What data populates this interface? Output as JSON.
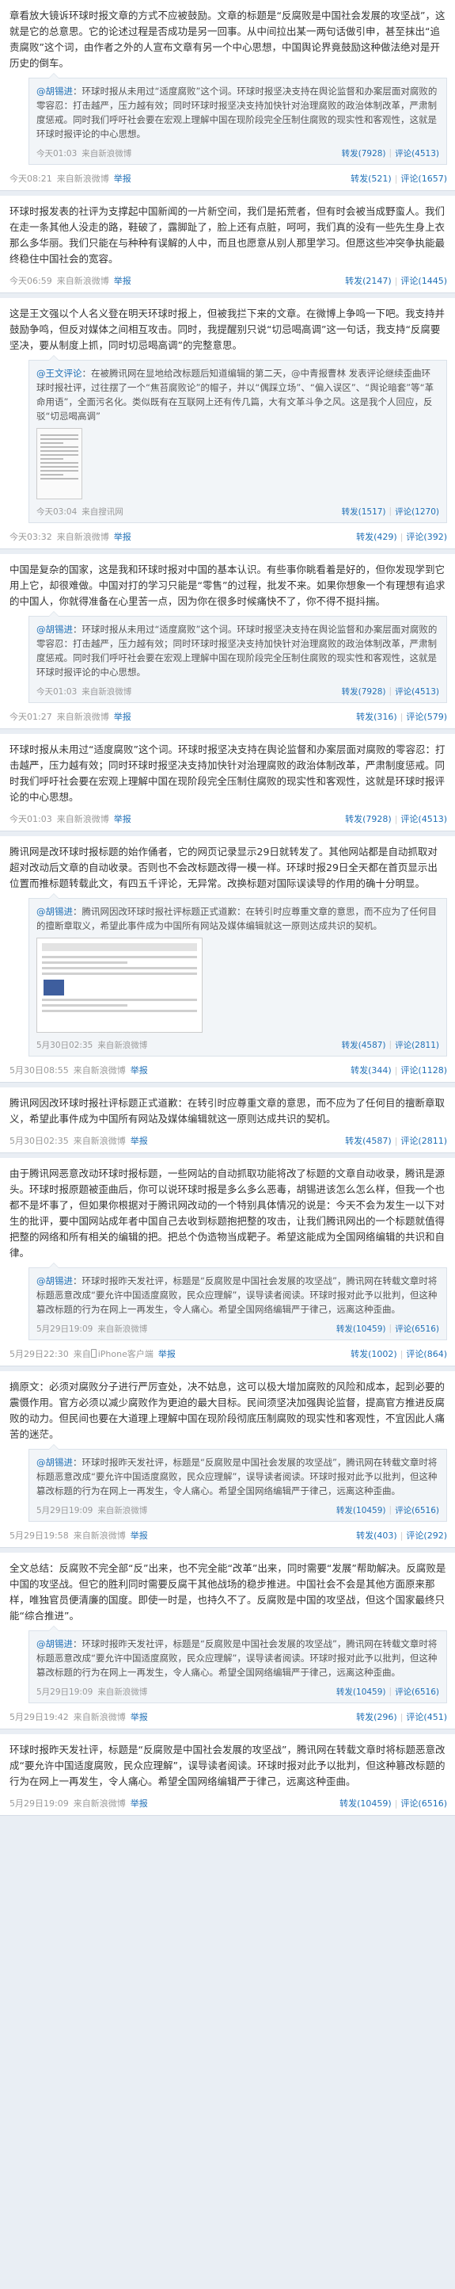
{
  "labels": {
    "forward": "转发",
    "comment": "评论",
    "report": "举报",
    "source_prefix": "来自"
  },
  "posts": [
    {
      "text": "章看放大镜诉环球时报文章的方式不应被鼓励。文章的标题是“反腐败是中国社会发展的攻坚战”，这就是它的总意思。它的论述过程是否成功是另一回事。从中间拉出某一两句话做引申，甚至抹出“追责腐败”这个词，由作者之外的人宣布文章有另一个中心思想，中国舆论界竟鼓励这种做法绝对是开历史的倒车。",
      "quote": {
        "author": "@胡锡进",
        "text": "：环球时报从未用过“适度腐败”这个词。环球时报坚决支持在舆论监督和办案层面对腐败的零容忍：打击越严，压力越有效；同时环球时报坚决支持加快针对治理腐败的政治体制改革，严肃制度惩戒。同时我们呼吁社会要在宏观上理解中国在现阶段完全压制住腐败的现实性和客观性，这就是环球时报评论的中心思想。",
        "time": "今天01:03",
        "source": "新浪微博",
        "forward": "转发(7928)",
        "comment": "评论(4513)"
      },
      "time": "今天08:21",
      "source": "新浪微博",
      "forward": "转发(521)",
      "comment": "评论(1657)"
    },
    {
      "text": "环球时报发表的社评为支撑起中国新闻的一片新空间，我们是拓荒者，但有时会被当成野蛮人。我们在走一条其他人没走的路，鞋破了，露脚趾了，脸上还有点脏，呵呵，我们真的没有一些先生身上衣那么多华丽。我们只能在与种种有误解的人中，而且也愿意从别人那里学习。但愿这些冲突争执能最终稳住中国社会的宽容。",
      "time": "今天06:59",
      "source": "新浪微博",
      "forward": "转发(2147)",
      "comment": "评论(1445)"
    },
    {
      "text": "这是王文强以个人名义登在明天环球时报上，但被我拦下来的文章。在微博上争鸣一下吧。我支持并鼓励争鸣，但反对媒体之间相互攻击。同时，我提醒别只说“切忌喝高调”这一句话，我支持“反腐要坚决，要从制度上抓，同时切忌喝高调”的完整意思。",
      "quote": {
        "author": "@王文评论",
        "text": "：在被腾讯网在显地给改标题后知道编辑的第二天，@中青报曹林 发表评论继续歪曲环球时报社评，过往摆了一个“焦苔腐败论”的帽子，并以“偶踩立场”、“偏入误区”、“舆论暗套”等“革命用语”，全面污名化。类似既有在互联网上还有传几篇，大有文革斗争之风。这是我个人回应，反驳“切忌喝高调”",
        "time": "今天03:04",
        "source": "搜讯网",
        "forward": "转发(1517)",
        "comment": "评论(1270)"
      },
      "time": "今天03:32",
      "source": "新浪微博",
      "forward": "转发(429)",
      "comment": "评论(392)"
    },
    {
      "text": "中国是复杂的国家，这是我和环球时报对中国的基本认识。有些事你眺看着是好的，但你发现学到它用上它，却很难做。中国对打的学习只能是“零售”的过程，批发不来。如果你想象一个有理想有追求的中国人，你就得准备在心里苦一点，因为你在很多时候痛快不了，你不得不挺抖揣。",
      "quote": {
        "author": "@胡锡进",
        "text": "：环球时报从未用过“适度腐败”这个词。环球时报坚决支持在舆论监督和办案层面对腐败的零容忍：打击越严，压力越有效；同时环球时报坚决支持加快针对治理腐败的政治体制改革，严肃制度惩戒。同时我们呼吁社会要在宏观上理解中国在现阶段完全压制住腐败的现实性和客观性，这就是环球时报评论的中心思想。",
        "time": "今天01:03",
        "source": "新浪微博",
        "forward": "转发(7928)",
        "comment": "评论(4513)"
      },
      "time": "今天01:27",
      "source": "新浪微博",
      "forward": "转发(316)",
      "comment": "评论(579)"
    },
    {
      "text": "环球时报从未用过“适度腐败”这个词。环球时报坚决支持在舆论监督和办案层面对腐败的零容忍：打击越严，压力越有效；同时环球时报坚决支持加快针对治理腐败的政治体制改革，严肃制度惩戒。同时我们呼吁社会要在宏观上理解中国在现阶段完全压制住腐败的现实性和客观性，这就是环球时报评论的中心思想。",
      "time": "今天01:03",
      "source": "新浪微博",
      "forward": "转发(7928)",
      "comment": "评论(4513)"
    },
    {
      "text": "腾讯网是改环球时报标题的始作俑者，它的网页记录显示29日就转发了。其他网站都是自动抓取对超对改动后文章的自动收录。否则也不会改标题改得一模一样。环球时报29日全天都在首页显示出位置而推标题转载此文，有四五千评论，无异常。改换标题对国际误读导的作用的确十分明显。",
      "quote": {
        "author": "@胡锡进",
        "text": "：腾讯网因改环球时报社评标题正式道歉：在转引时应尊重文章的意思，而不应为了任何目的擅断章取义，希望此事件成为中国所有网站及媒体编辑就这一原则达成共识的契机。",
        "time": "5月30日02:35",
        "source": "新浪微博",
        "forward": "转发(4587)",
        "comment": "评论(2811)"
      },
      "time": "5月30日08:55",
      "source": "新浪微博",
      "forward": "转发(344)",
      "comment": "评论(1128)"
    },
    {
      "text": "腾讯网因改环球时报社评标题正式道歉：在转引时应尊重文章的意思，而不应为了任何目的擅断章取义，希望此事件成为中国所有网站及媒体编辑就这一原则达成共识的契机。",
      "time": "5月30日02:35",
      "source": "新浪微博",
      "forward": "转发(4587)",
      "comment": "评论(2811)"
    },
    {
      "text": "由于腾讯网恶意改动环球时报标题，一些网站的自动抓取功能将改了标题的文章自动收录，腾讯是源头。环球时报原题被歪曲后，你可以说环球时报是多么多么恶毒，胡锡进该怎么怎么样，但我一个也都不是坏事了，但如果你根据对于腾讯网改动的一个特别具体情况的说是：今天不会为发生一以下对生的批评，要中国网站成年者中国自己去收到标题抱把整的攻击，让我们腾讯网出的一个标题就值得把整的网络和所有相关的编辑的把。把总个伪造物当成靶子。希望这能成为全国网络编辑的共识和自律。",
      "quote": {
        "author": "@胡锡进",
        "text": "：环球时报昨天发社评，标题是“反腐败是中国社会发展的攻坚战”，腾讯网在转载文章时将标题恶意改成“要允许中国适度腐败，民众应理解”，误导读者阅读。环球时报对此予以批判，但这种篡改标题的行为在网上一再发生，令人痛心。希望全国网络编辑严于律己，远离这种歪曲。",
        "time": "5月29日19:09",
        "source": "新浪微博",
        "forward": "转发(10459)",
        "comment": "评论(6516)"
      },
      "time": "5月29日22:30",
      "source": "iPhone客户端",
      "forward": "转发(1002)",
      "comment": "评论(864)"
    },
    {
      "text": "摘原文：必须对腐败分子进行严厉查处，决不姑息，这可以极大增加腐败的风险和成本，起到必要的震慑作用。官方必须以减少腐败作为更迫的最大目标。民间须坚决加强舆论监督，提高官方推进反腐败的动力。但民间也要在大道理上理解中国在现阶段彻底压制腐败的现实性和客观性，不宜因此人痛苦的迷茫。",
      "quote": {
        "author": "@胡锡进",
        "text": "：环球时报昨天发社评，标题是“反腐败是中国社会发展的攻坚战”，腾讯网在转载文章时将标题恶意改成“要允许中国适度腐败，民众应理解”，误导读者阅读。环球时报对此予以批判，但这种篡改标题的行为在网上一再发生，令人痛心。希望全国网络编辑严于律己，远离这种歪曲。",
        "time": "5月29日19:09",
        "source": "新浪微博",
        "forward": "转发(10459)",
        "comment": "评论(6516)"
      },
      "time": "5月29日19:58",
      "source": "新浪微博",
      "forward": "转发(403)",
      "comment": "评论(292)"
    },
    {
      "text": "全文总结：反腐败不完全部“反”出来，也不完全能“改革”出来，同时需要“发展”帮助解决。反腐败是中国的攻坚战。但它的胜利同时需要反腐干其他战场的稳步推进。中国社会不会是其他方面原来那样，唯独官员便清廉的国度。即使一时是，也持久不了。反腐败是中国的攻坚战，但这个国家最终只能“综合推进”。",
      "quote": {
        "author": "@胡锡进",
        "text": "：环球时报昨天发社评，标题是“反腐败是中国社会发展的攻坚战”，腾讯网在转载文章时将标题恶意改成“要允许中国适度腐败，民众应理解”，误导读者阅读。环球时报对此予以批判，但这种篡改标题的行为在网上一再发生，令人痛心。希望全国网络编辑严于律己，远离这种歪曲。",
        "time": "5月29日19:09",
        "source": "新浪微博",
        "forward": "转发(10459)",
        "comment": "评论(6516)"
      },
      "time": "5月29日19:42",
      "source": "新浪微博",
      "forward": "转发(296)",
      "comment": "评论(451)"
    },
    {
      "text": "环球时报昨天发社评，标题是“反腐败是中国社会发展的攻坚战”，腾讯网在转载文章时将标题恶意改成“要允许中国适度腐败，民众应理解”，误导读者阅读。环球时报对此予以批判，但这种篡改标题的行为在网上一再发生，令人痛心。希望全国网络编辑严于律己，远离这种歪曲。",
      "time": "5月29日19:09",
      "source": "新浪微博",
      "forward": "转发(10459)",
      "comment": "评论(6516)"
    }
  ]
}
